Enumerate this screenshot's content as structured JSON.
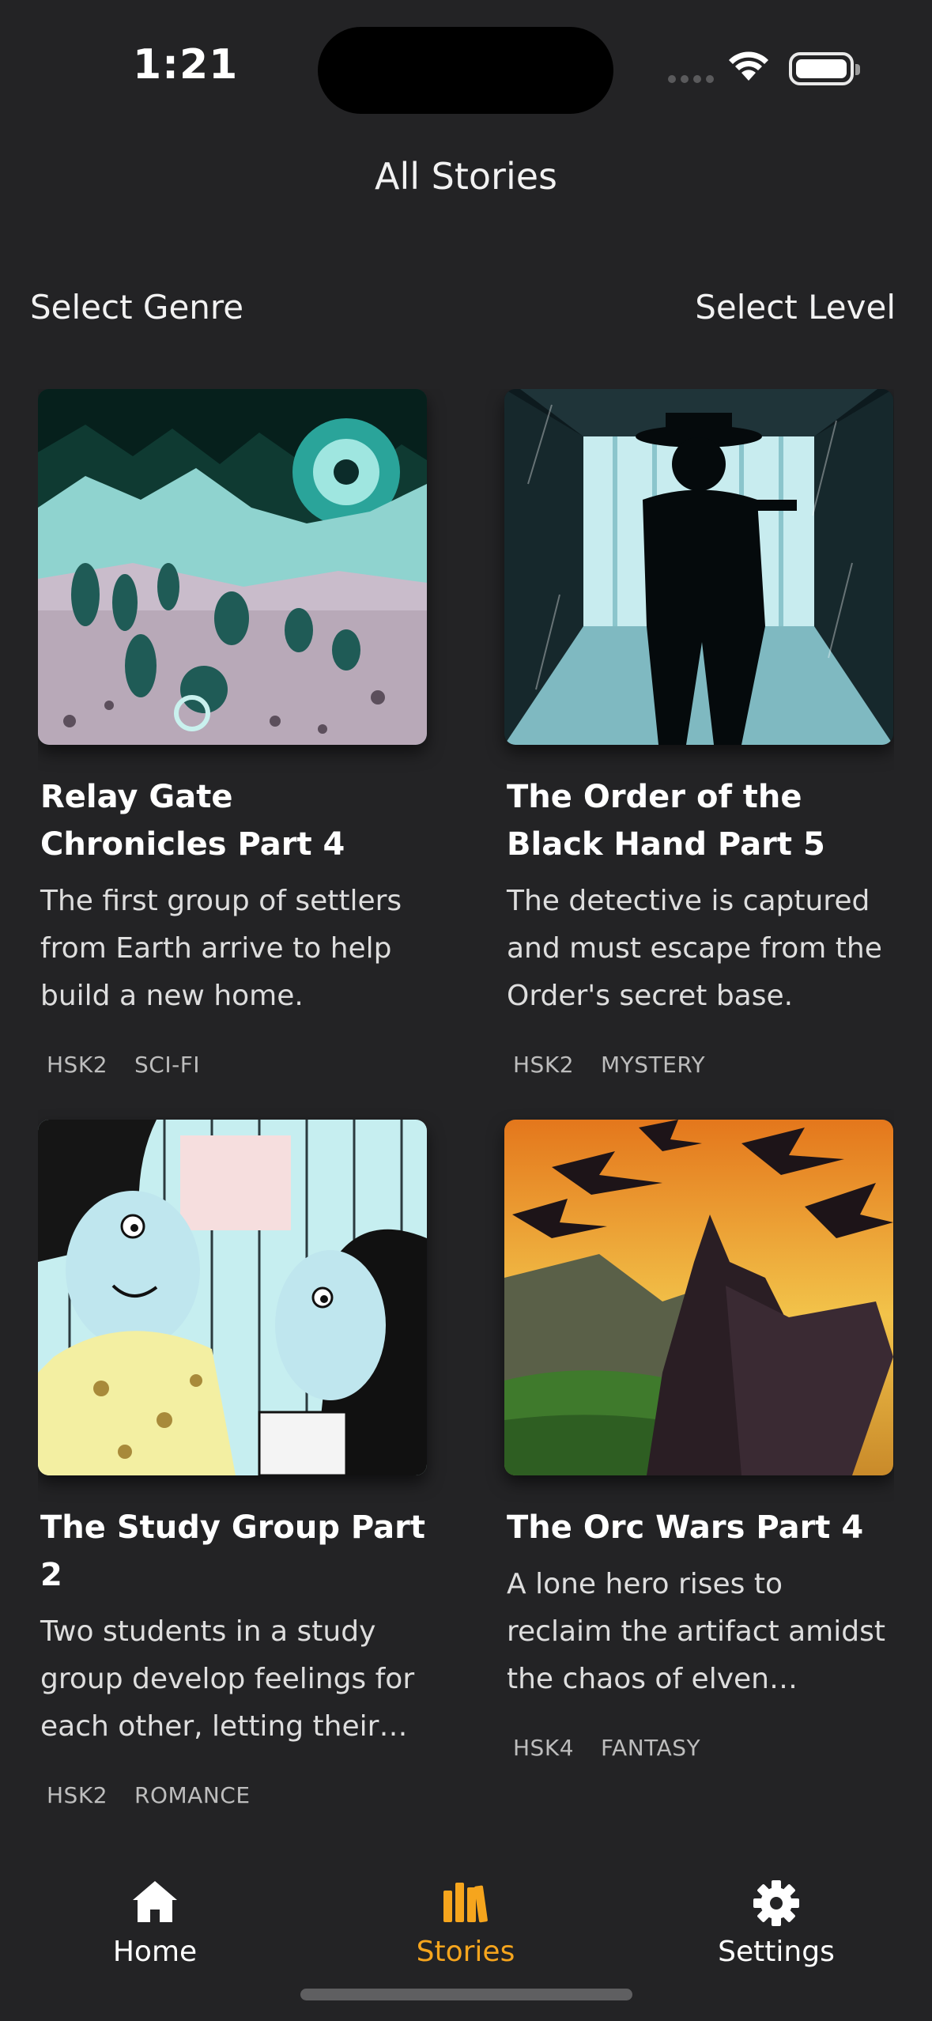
{
  "status": {
    "time": "1:21"
  },
  "header": {
    "title": "All Stories"
  },
  "filters": {
    "genre_label": "Select Genre",
    "level_label": "Select Level"
  },
  "stories": [
    {
      "title": "Relay Gate Chronicles Part 4",
      "description": "The first group of settlers from Earth arrive to help build a new home.",
      "level": "HSK2",
      "genre": "SCI-FI"
    },
    {
      "title": "The Order of the Black Hand Part 5",
      "description": "The detective is captured and must escape from the Order's secret base.",
      "level": "HSK2",
      "genre": "MYSTERY"
    },
    {
      "title": "The Study Group Part 2",
      "description": "Two students in a study group develop feelings for each other, letting their actions speak louder than words.",
      "level": "HSK2",
      "genre": "ROMANCE"
    },
    {
      "title": "The Orc Wars Part 4",
      "description": "A lone hero rises to reclaim the artifact amidst the chaos of elven betrayal.",
      "level": "HSK4",
      "genre": "FANTASY"
    }
  ],
  "tabbar": {
    "home": "Home",
    "stories": "Stories",
    "settings": "Settings",
    "active_color": "#f6a51d"
  },
  "icons": {
    "home": "house-icon",
    "stories": "books-icon",
    "settings": "gear-icon"
  }
}
